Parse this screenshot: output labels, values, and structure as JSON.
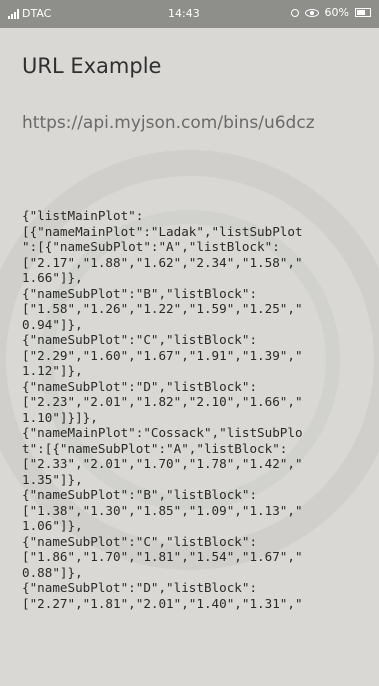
{
  "status_bar": {
    "carrier": "DTAC",
    "time": "14:43",
    "battery": "60%"
  },
  "app_title": "URL Example",
  "url": "https://api.myjson.com/bins/u6dcz",
  "json_lines": [
    "{\"listMainPlot\":",
    "[{\"nameMainPlot\":\"Ladak\",\"listSubPlot",
    "\":[{\"nameSubPlot\":\"A\",\"listBlock\":",
    "[\"2.17\",\"1.88\",\"1.62\",\"2.34\",\"1.58\",\"",
    "1.66\"]},",
    "{\"nameSubPlot\":\"B\",\"listBlock\":",
    "[\"1.58\",\"1.26\",\"1.22\",\"1.59\",\"1.25\",\"",
    "0.94\"]},",
    "{\"nameSubPlot\":\"C\",\"listBlock\":",
    "[\"2.29\",\"1.60\",\"1.67\",\"1.91\",\"1.39\",\"",
    "1.12\"]},",
    "{\"nameSubPlot\":\"D\",\"listBlock\":",
    "[\"2.23\",\"2.01\",\"1.82\",\"2.10\",\"1.66\",\"",
    "1.10\"]}]},",
    "{\"nameMainPlot\":\"Cossack\",\"listSubPlo",
    "t\":[{\"nameSubPlot\":\"A\",\"listBlock\":",
    "[\"2.33\",\"2.01\",\"1.70\",\"1.78\",\"1.42\",\"",
    "1.35\"]},",
    "{\"nameSubPlot\":\"B\",\"listBlock\":",
    "[\"1.38\",\"1.30\",\"1.85\",\"1.09\",\"1.13\",\"",
    "1.06\"]},",
    "{\"nameSubPlot\":\"C\",\"listBlock\":",
    "[\"1.86\",\"1.70\",\"1.81\",\"1.54\",\"1.67\",\"",
    "0.88\"]},",
    "{\"nameSubPlot\":\"D\",\"listBlock\":",
    "[\"2.27\",\"1.81\",\"2.01\",\"1.40\",\"1.31\",\""
  ]
}
